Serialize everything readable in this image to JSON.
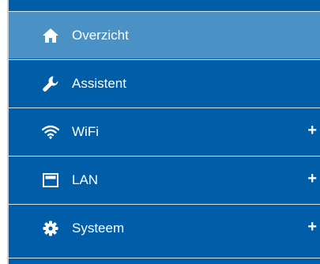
{
  "nav": {
    "items": [
      {
        "label": "Overzicht",
        "icon": "home-icon",
        "active": true,
        "expandable": false
      },
      {
        "label": "Assistent",
        "icon": "wrench-icon",
        "active": false,
        "expandable": false
      },
      {
        "label": "WiFi",
        "icon": "wifi-icon",
        "active": false,
        "expandable": true,
        "expand_symbol": "+"
      },
      {
        "label": "LAN",
        "icon": "lan-window-icon",
        "active": false,
        "expandable": true,
        "expand_symbol": "+"
      },
      {
        "label": "Systeem",
        "icon": "gear-icon",
        "active": false,
        "expandable": true,
        "expand_symbol": "+"
      }
    ]
  },
  "colors": {
    "menu_bg": "#005ea8",
    "active_bg": "#4a92c6",
    "divider": "#d8e6f2",
    "text": "#ffffff"
  }
}
